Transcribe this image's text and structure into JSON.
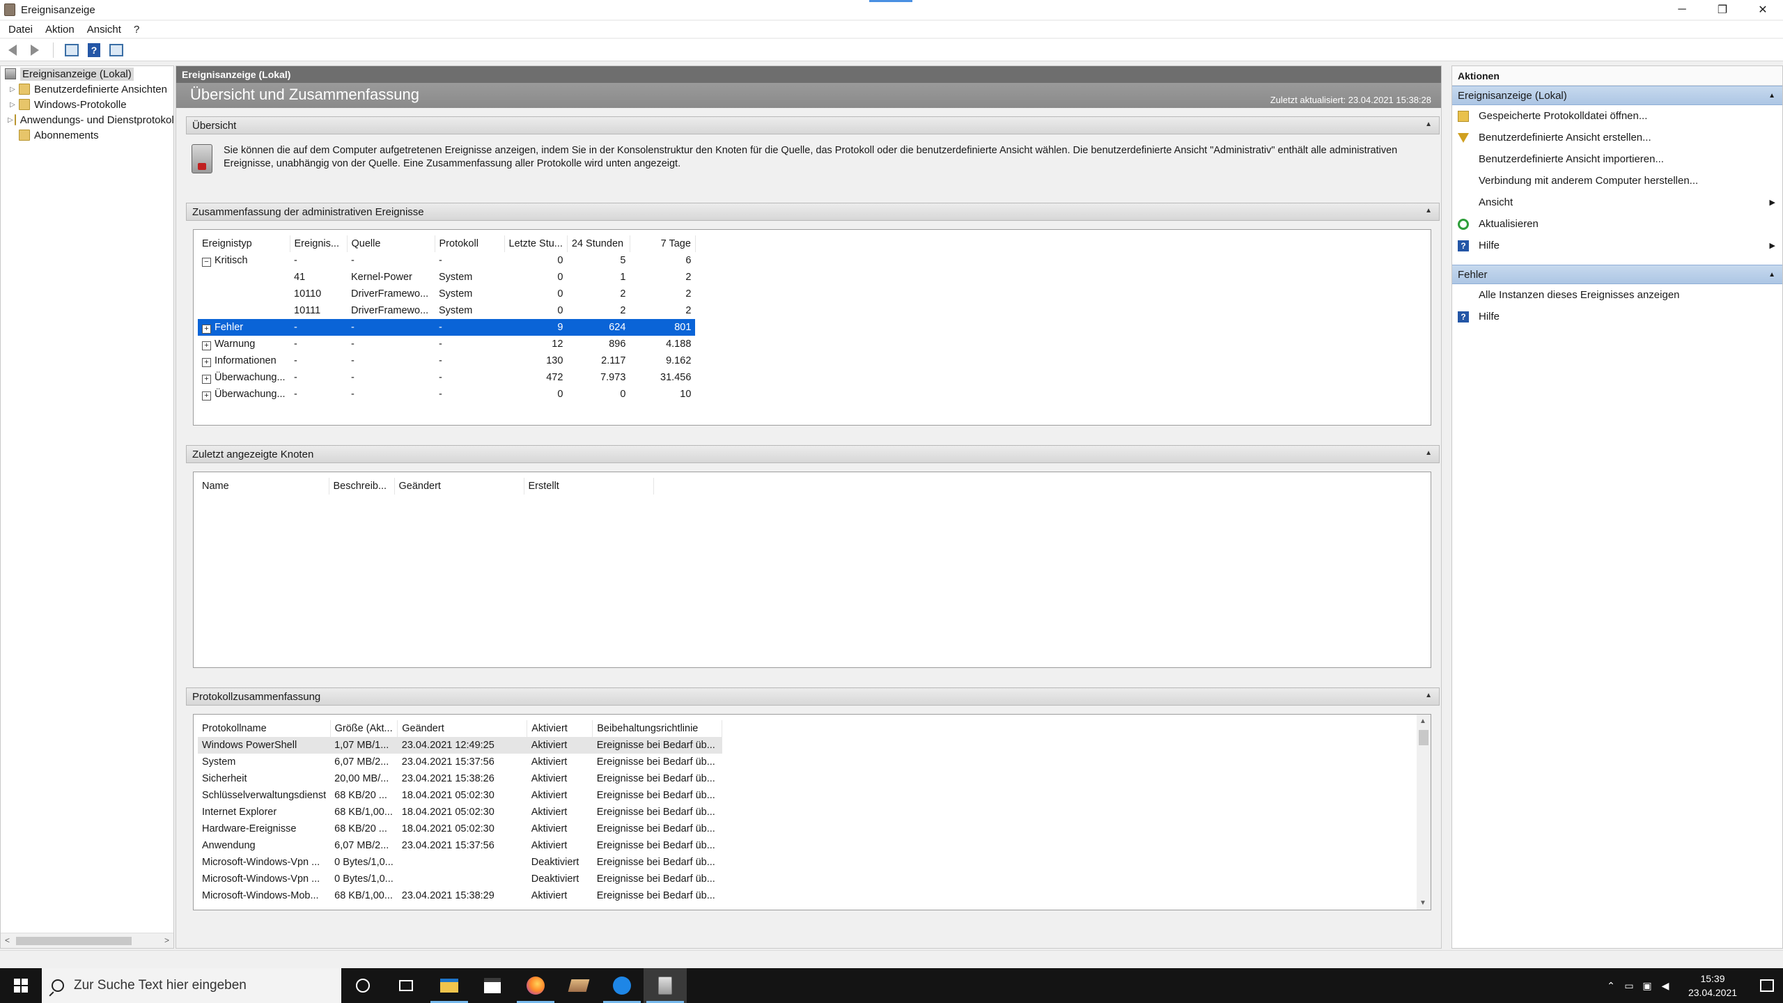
{
  "window": {
    "title": "Ereignisanzeige",
    "controls": {
      "minimize": "─",
      "restore": "❐",
      "close": "✕"
    }
  },
  "menu": [
    "Datei",
    "Aktion",
    "Ansicht",
    "?"
  ],
  "tree": {
    "root": "Ereignisanzeige (Lokal)",
    "items": [
      "Benutzerdefinierte Ansichten",
      "Windows-Protokolle",
      "Anwendungs- und Dienstprotokolle",
      "Abonnements"
    ]
  },
  "center": {
    "header": "Ereignisanzeige (Lokal)",
    "banner_title": "Übersicht und Zusammenfassung",
    "last_updated": "Zuletzt aktualisiert: 23.04.2021 15:38:28",
    "overview": {
      "title": "Übersicht",
      "text": "Sie können die auf dem Computer aufgetretenen Ereignisse anzeigen, indem Sie in der Konsolenstruktur den Knoten für die Quelle, das Protokoll oder die benutzerdefinierte Ansicht wählen. Die benutzerdefinierte Ansicht \"Administrativ\" enthält alle administrativen Ereignisse, unabhängig von der Quelle. Eine Zusammenfassung aller Protokolle wird unten angezeigt."
    },
    "summary": {
      "title": "Zusammenfassung der administrativen Ereignisse",
      "columns": [
        "Ereignistyp",
        "Ereignis...",
        "Quelle",
        "Protokoll",
        "Letzte Stu...",
        "24 Stunden",
        "7 Tage"
      ],
      "rows": [
        {
          "expander": "−",
          "type": "Kritisch",
          "id": "-",
          "source": "-",
          "log": "-",
          "hour": "0",
          "day": "5",
          "week": "6"
        },
        {
          "expander": "",
          "type": "",
          "id": "41",
          "source": "Kernel-Power",
          "log": "System",
          "hour": "0",
          "day": "1",
          "week": "2"
        },
        {
          "expander": "",
          "type": "",
          "id": "10110",
          "source": "DriverFramewo...",
          "log": "System",
          "hour": "0",
          "day": "2",
          "week": "2"
        },
        {
          "expander": "",
          "type": "",
          "id": "10111",
          "source": "DriverFramewo...",
          "log": "System",
          "hour": "0",
          "day": "2",
          "week": "2"
        },
        {
          "expander": "+",
          "type": "Fehler",
          "id": "-",
          "source": "-",
          "log": "-",
          "hour": "9",
          "day": "624",
          "week": "801"
        },
        {
          "expander": "+",
          "type": "Warnung",
          "id": "-",
          "source": "-",
          "log": "-",
          "hour": "12",
          "day": "896",
          "week": "4.188"
        },
        {
          "expander": "+",
          "type": "Informationen",
          "id": "-",
          "source": "-",
          "log": "-",
          "hour": "130",
          "day": "2.117",
          "week": "9.162"
        },
        {
          "expander": "+",
          "type": "Überwachung...",
          "id": "-",
          "source": "-",
          "log": "-",
          "hour": "472",
          "day": "7.973",
          "week": "31.456"
        },
        {
          "expander": "+",
          "type": "Überwachung...",
          "id": "-",
          "source": "-",
          "log": "-",
          "hour": "0",
          "day": "0",
          "week": "10"
        }
      ]
    },
    "recent": {
      "title": "Zuletzt angezeigte Knoten",
      "columns": [
        "Name",
        "Beschreib...",
        "Geändert",
        "Erstellt"
      ]
    },
    "logs": {
      "title": "Protokollzusammenfassung",
      "columns": [
        "Protokollname",
        "Größe (Akt...",
        "Geändert",
        "Aktiviert",
        "Beibehaltungsrichtlinie"
      ],
      "rows": [
        [
          "Windows PowerShell",
          "1,07 MB/1...",
          "23.04.2021 12:49:25",
          "Aktiviert",
          "Ereignisse bei Bedarf üb..."
        ],
        [
          "System",
          "6,07 MB/2...",
          "23.04.2021 15:37:56",
          "Aktiviert",
          "Ereignisse bei Bedarf üb..."
        ],
        [
          "Sicherheit",
          "20,00 MB/...",
          "23.04.2021 15:38:26",
          "Aktiviert",
          "Ereignisse bei Bedarf üb..."
        ],
        [
          "Schlüsselverwaltungsdienst",
          "68 KB/20 ...",
          "18.04.2021 05:02:30",
          "Aktiviert",
          "Ereignisse bei Bedarf üb..."
        ],
        [
          "Internet Explorer",
          "68 KB/1,00...",
          "18.04.2021 05:02:30",
          "Aktiviert",
          "Ereignisse bei Bedarf üb..."
        ],
        [
          "Hardware-Ereignisse",
          "68 KB/20 ...",
          "18.04.2021 05:02:30",
          "Aktiviert",
          "Ereignisse bei Bedarf üb..."
        ],
        [
          "Anwendung",
          "6,07 MB/2...",
          "23.04.2021 15:37:56",
          "Aktiviert",
          "Ereignisse bei Bedarf üb..."
        ],
        [
          "Microsoft-Windows-Vpn ...",
          "0 Bytes/1,0...",
          "",
          "Deaktiviert",
          "Ereignisse bei Bedarf üb..."
        ],
        [
          "Microsoft-Windows-Vpn ...",
          "0 Bytes/1,0...",
          "",
          "Deaktiviert",
          "Ereignisse bei Bedarf üb..."
        ],
        [
          "Microsoft-Windows-Mob...",
          "68 KB/1,00...",
          "23.04.2021 15:38:29",
          "Aktiviert",
          "Ereignisse bei Bedarf üb..."
        ]
      ]
    }
  },
  "actions": {
    "header": "Aktionen",
    "group1": {
      "title": "Ereignisanzeige (Lokal)",
      "items": [
        {
          "label": "Gespeicherte Protokolldatei öffnen...",
          "icon": "open"
        },
        {
          "label": "Benutzerdefinierte Ansicht erstellen...",
          "icon": "filter"
        },
        {
          "label": "Benutzerdefinierte Ansicht importieren...",
          "icon": ""
        },
        {
          "label": "Verbindung mit anderem Computer herstellen...",
          "icon": ""
        },
        {
          "label": "Ansicht",
          "icon": "",
          "submenu": true
        },
        {
          "label": "Aktualisieren",
          "icon": "refresh"
        },
        {
          "label": "Hilfe",
          "icon": "help",
          "submenu": true
        }
      ]
    },
    "group2": {
      "title": "Fehler",
      "items": [
        {
          "label": "Alle Instanzen dieses Ereignisses anzeigen",
          "icon": ""
        },
        {
          "label": "Hilfe",
          "icon": "help"
        }
      ]
    }
  },
  "taskbar": {
    "search_placeholder": "Zur Suche Text hier eingeben",
    "time": "15:39",
    "date": "23.04.2021"
  }
}
